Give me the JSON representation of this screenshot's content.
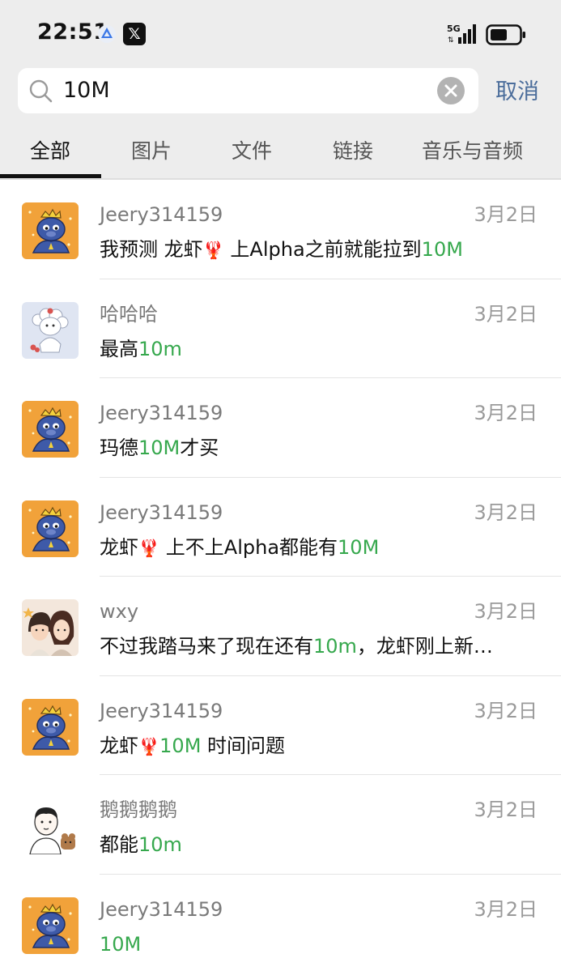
{
  "status": {
    "time": "22:51",
    "network": "5G",
    "icons": [
      "app-a-icon",
      "x-app-icon",
      "signal-icon",
      "battery-icon"
    ]
  },
  "search": {
    "query": "10M",
    "cancel": "取消"
  },
  "tabs": [
    "全部",
    "图片",
    "文件",
    "链接",
    "音乐与音频"
  ],
  "active_tab": "全部",
  "colors": {
    "highlight": "#36a84d",
    "cancel": "#4b6d9b",
    "header_bg": "#ededed"
  },
  "results": [
    {
      "name": "Jeery314159",
      "date": "3月2日",
      "avatar": "tiger-avatar",
      "parts": [
        [
          "我预测 龙虾",
          false
        ],
        [
          "🦞",
          false
        ],
        [
          " 上Alpha之前就能拉到",
          false
        ],
        [
          "10M",
          true
        ]
      ]
    },
    {
      "name": "哈哈哈",
      "date": "3月2日",
      "avatar": "sheep-avatar",
      "parts": [
        [
          "最高",
          false
        ],
        [
          "10m",
          true
        ]
      ]
    },
    {
      "name": "Jeery314159",
      "date": "3月2日",
      "avatar": "tiger-avatar",
      "parts": [
        [
          "玛德",
          false
        ],
        [
          "10M",
          true
        ],
        [
          "才买",
          false
        ]
      ]
    },
    {
      "name": "Jeery314159",
      "date": "3月2日",
      "avatar": "tiger-avatar",
      "parts": [
        [
          "龙虾",
          false
        ],
        [
          "🦞",
          false
        ],
        [
          " 上不上Alpha都能有",
          false
        ],
        [
          "10M",
          true
        ]
      ]
    },
    {
      "name": "wxy",
      "date": "3月2日",
      "avatar": "couple-avatar",
      "parts": [
        [
          "不过我踏马来了现在还有",
          false
        ],
        [
          "10m",
          true
        ],
        [
          "，龙虾刚上新…",
          false
        ]
      ]
    },
    {
      "name": "Jeery314159",
      "date": "3月2日",
      "avatar": "tiger-avatar",
      "parts": [
        [
          "龙虾",
          false
        ],
        [
          "🦞",
          false
        ],
        [
          "10M",
          true
        ],
        [
          " 时间问题",
          false
        ]
      ]
    },
    {
      "name": "鹅鹅鹅鹅",
      "date": "3月2日",
      "avatar": "cartoon-man-avatar",
      "parts": [
        [
          "都能",
          false
        ],
        [
          "10m",
          true
        ]
      ]
    },
    {
      "name": "Jeery314159",
      "date": "3月2日",
      "avatar": "tiger-avatar",
      "parts": [
        [
          "10M",
          true
        ]
      ]
    }
  ]
}
